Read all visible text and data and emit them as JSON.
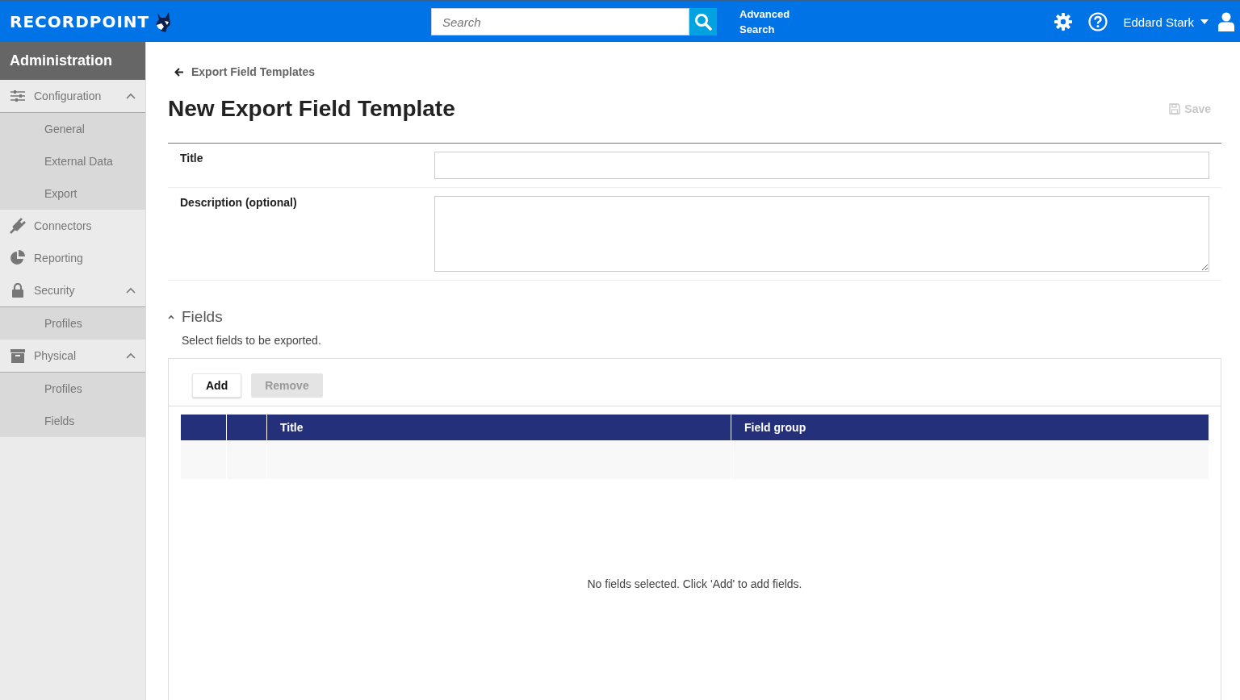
{
  "header": {
    "logo": "RECORDPOINT",
    "search": {
      "placeholder": "Search"
    },
    "advanced_search": "Advanced Search",
    "user": "Eddard Stark"
  },
  "sidebar": {
    "title": "Administration",
    "items": [
      {
        "label": "Configuration",
        "expanded": true,
        "children": [
          {
            "label": "General"
          },
          {
            "label": "External Data"
          },
          {
            "label": "Export"
          }
        ]
      },
      {
        "label": "Connectors"
      },
      {
        "label": "Reporting"
      },
      {
        "label": "Security",
        "expanded": true,
        "children": [
          {
            "label": "Profiles"
          }
        ]
      },
      {
        "label": "Physical",
        "expanded": true,
        "children": [
          {
            "label": "Profiles"
          },
          {
            "label": "Fields"
          }
        ]
      }
    ]
  },
  "breadcrumb": "Export Field Templates",
  "page_title": "New Export Field Template",
  "save": {
    "label": "Save",
    "disabled": true
  },
  "form": [
    {
      "kind": "input",
      "label": "Title"
    },
    {
      "kind": "textarea",
      "label": "Description (optional)"
    }
  ],
  "fields_section": {
    "title": "Fields",
    "expanded": true,
    "hint": "Select fields to be exported.",
    "buttons": [
      {
        "label": "Add",
        "disabled": false
      },
      {
        "label": "Remove",
        "disabled": true
      }
    ],
    "table": {
      "columns": [
        "Title",
        "Field group"
      ],
      "empty_message": "No fields selected. Click 'Add' to add fields."
    }
  }
}
